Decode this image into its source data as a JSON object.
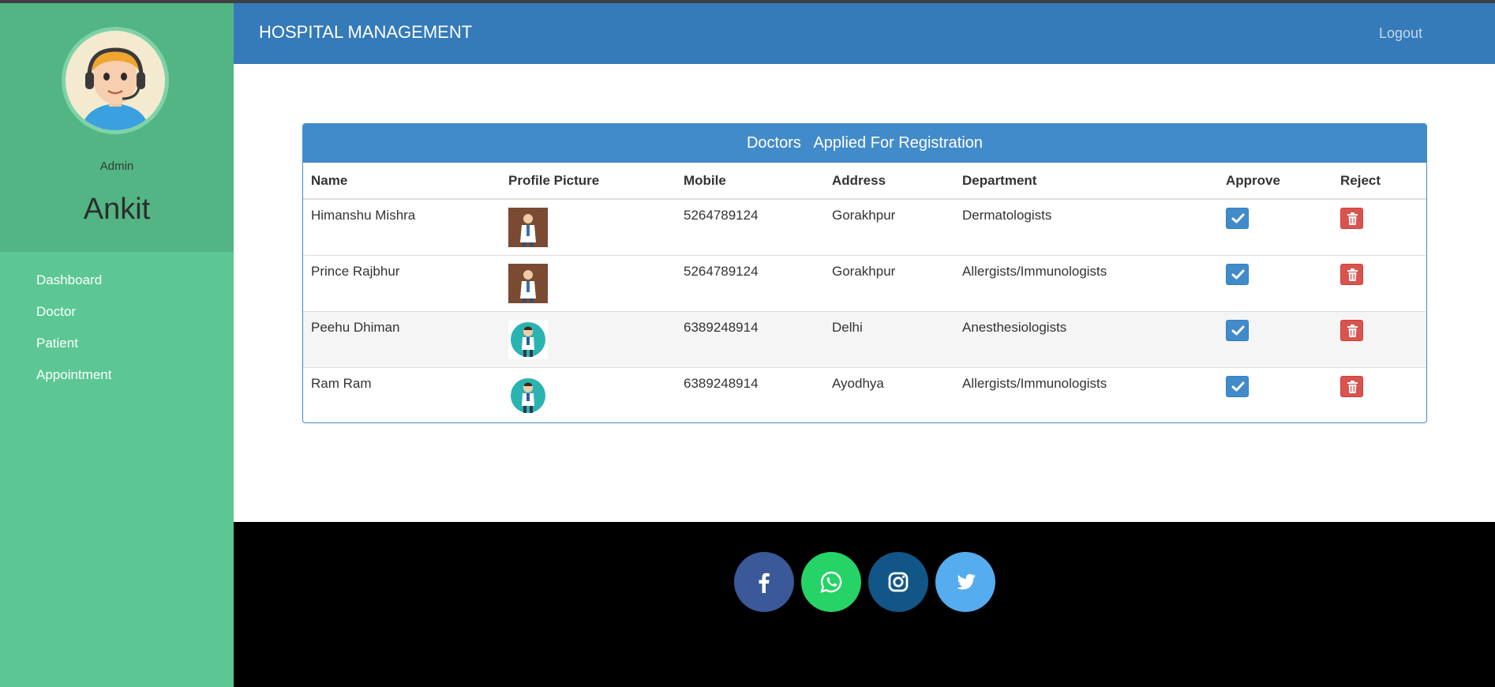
{
  "app": {
    "title": "HOSPITAL MANAGEMENT",
    "logout_label": "Logout"
  },
  "sidebar": {
    "role": "Admin",
    "username": "Ankit",
    "items": [
      {
        "label": "Dashboard"
      },
      {
        "label": "Doctor"
      },
      {
        "label": "Patient"
      },
      {
        "label": "Appointment"
      }
    ]
  },
  "panel": {
    "title": "Doctors   Applied For Registration",
    "columns": [
      "Name",
      "Profile Picture",
      "Mobile",
      "Address",
      "Department",
      "Approve",
      "Reject"
    ],
    "rows": [
      {
        "name": "Himanshu Mishra",
        "picture": "doctor-photo-brown",
        "mobile": "5264789124",
        "address": "Gorakhpur",
        "department": "Dermatologists"
      },
      {
        "name": "Prince Rajbhur",
        "picture": "doctor-photo-brown",
        "mobile": "5264789124",
        "address": "Gorakhpur",
        "department": "Allergists/Immunologists"
      },
      {
        "name": "Peehu Dhiman",
        "picture": "doctor-cartoon-teal",
        "mobile": "6389248914",
        "address": "Delhi",
        "department": "Anesthesiologists"
      },
      {
        "name": "Ram Ram",
        "picture": "doctor-cartoon-teal",
        "mobile": "6389248914",
        "address": "Ayodhya",
        "department": "Allergists/Immunologists"
      }
    ]
  },
  "footer": {
    "social": [
      {
        "icon": "facebook-icon",
        "color": "#3b5998"
      },
      {
        "icon": "whatsapp-icon",
        "color": "#25d366"
      },
      {
        "icon": "instagram-icon",
        "color": "#125688"
      },
      {
        "icon": "twitter-icon",
        "color": "#55acee"
      }
    ]
  },
  "colors": {
    "header": "#357ab9",
    "sidebar": "#5cc794",
    "sidebar_profile": "#52b583",
    "panel_accent": "#428bca",
    "approve": "#428bca",
    "reject": "#d9534f"
  }
}
